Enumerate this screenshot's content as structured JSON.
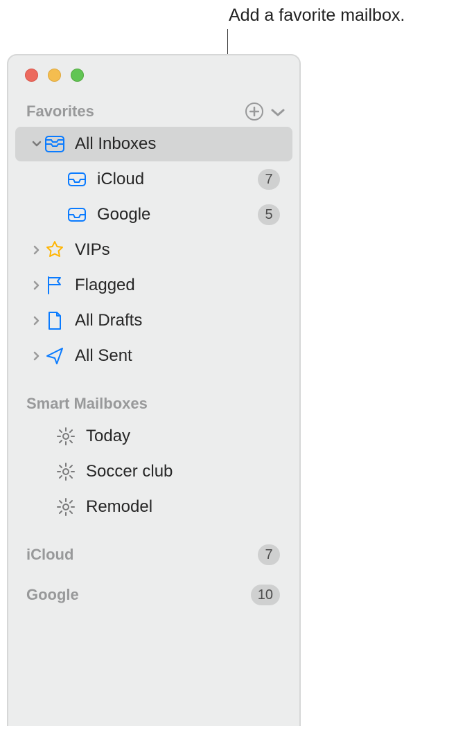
{
  "annotation": "Add a favorite mailbox.",
  "sections": {
    "favorites": {
      "title": "Favorites",
      "items": {
        "all_inboxes": {
          "label": "All Inboxes"
        },
        "icloud": {
          "label": "iCloud",
          "badge": "7"
        },
        "google": {
          "label": "Google",
          "badge": "5"
        },
        "vips": {
          "label": "VIPs"
        },
        "flagged": {
          "label": "Flagged"
        },
        "all_drafts": {
          "label": "All Drafts"
        },
        "all_sent": {
          "label": "All Sent"
        }
      }
    },
    "smart": {
      "title": "Smart Mailboxes",
      "items": {
        "today": {
          "label": "Today"
        },
        "soccer": {
          "label": "Soccer club"
        },
        "remodel": {
          "label": "Remodel"
        }
      }
    },
    "accounts": {
      "icloud": {
        "label": "iCloud",
        "badge": "7"
      },
      "google": {
        "label": "Google",
        "badge": "10"
      }
    }
  }
}
